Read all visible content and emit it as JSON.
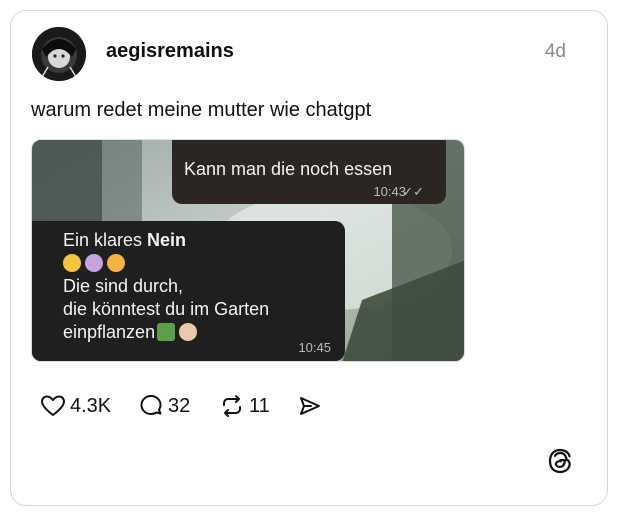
{
  "post": {
    "username": "aegisremains",
    "time": "4d",
    "caption": "warum redet meine mutter wie chatgpt"
  },
  "media": {
    "messages": {
      "outgoing": {
        "text": "Kann man die noch essen",
        "time": "10:43"
      },
      "incoming": {
        "line1_prefix": "Ein klares ",
        "line1_bold": "Nein",
        "line3": "Die sind durch,",
        "line4": "die könntest du im Garten",
        "line5": "einpflanzen",
        "time": "10:45"
      }
    }
  },
  "actions": {
    "likes": "4.3K",
    "replies": "32",
    "reposts": "11"
  },
  "colors": {
    "text": "#111111",
    "muted": "#8a8a8a",
    "border": "#d9d9d9",
    "bubble": "#1f1f1f"
  },
  "icons": {
    "like": "heart-icon",
    "reply": "comment-icon",
    "repost": "repost-icon",
    "share": "send-icon",
    "logo": "threads-logo-icon"
  }
}
